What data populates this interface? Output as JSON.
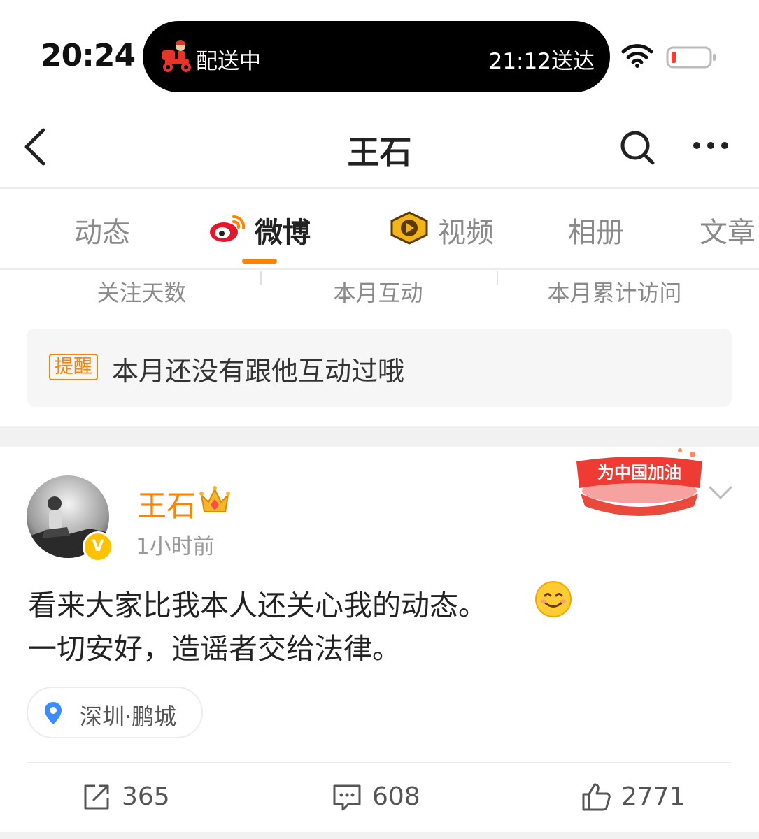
{
  "status_bar": {
    "time": "20:24",
    "island_label": "配送中",
    "island_eta": "21:12送达"
  },
  "nav": {
    "title": "王石"
  },
  "tabs": [
    {
      "label": "动态",
      "active": false
    },
    {
      "label": "微博",
      "active": true
    },
    {
      "label": "视频",
      "active": false
    },
    {
      "label": "相册",
      "active": false
    },
    {
      "label": "文章",
      "active": false
    }
  ],
  "stats": [
    "关注天数",
    "本月互动",
    "本月累计访问"
  ],
  "reminder": {
    "tag": "提醒",
    "text": "本月还没有跟他互动过哦"
  },
  "post": {
    "author": "王石",
    "verified_badge": "V",
    "time": "1小时前",
    "sticker_text": "为中国加油",
    "text_lines": [
      "看来大家比我本人还关心我的动态。",
      "一切安好，造谣者交给法律。"
    ],
    "location": "深圳·鹏城",
    "reposts": "365",
    "comments": "608",
    "likes": "2771"
  },
  "colors": {
    "accent": "#ff8200",
    "verified": "#ffc200",
    "pin": "#3b8cff"
  }
}
